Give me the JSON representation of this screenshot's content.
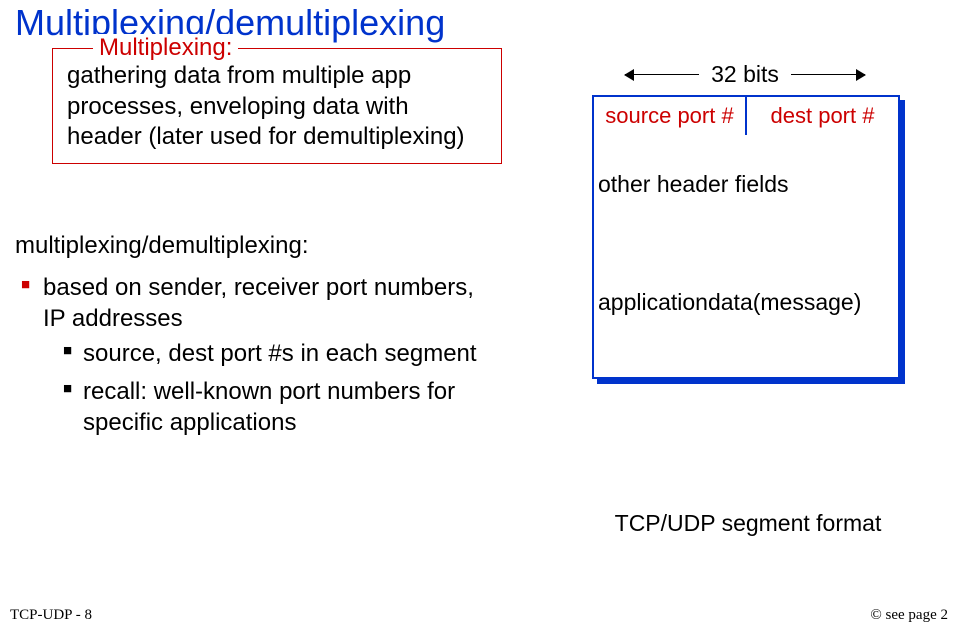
{
  "title": "Multiplexing/demultiplexing",
  "mux": {
    "legend": "Multiplexing:",
    "body": "gathering data from multiple app processes, enveloping data with header (later used for demultiplexing)"
  },
  "md_heading": "multiplexing/demultiplexing:",
  "bullets": {
    "b1": "based on sender, receiver port numbers, IP addresses",
    "sub1": "source, dest port #s in each segment",
    "sub2": "recall: well-known port numbers for specific applications"
  },
  "diagram": {
    "bits_label": "32 bits",
    "src_port": "source port #",
    "dst_port": "dest port #",
    "other_fields": "other header fields",
    "app_line1": "application",
    "app_line2": "data",
    "app_line3": "(message)",
    "caption": "TCP/UDP segment format"
  },
  "footer": {
    "left": "TCP-UDP - 8",
    "right": "© see page 2"
  }
}
